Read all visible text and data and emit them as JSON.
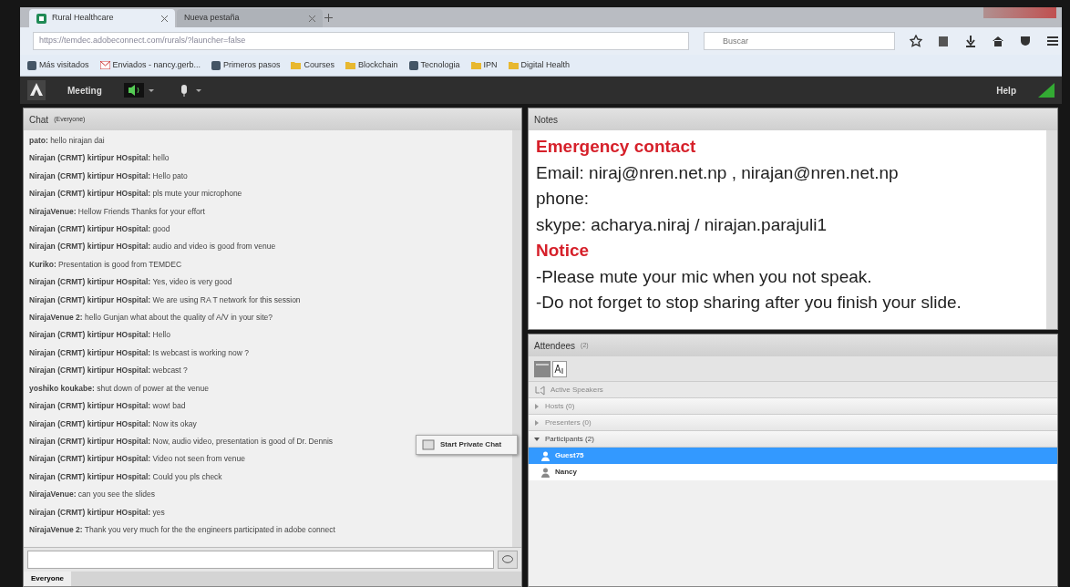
{
  "browser": {
    "tabs": [
      {
        "label": "Rural Healthcare",
        "selected": true
      },
      {
        "label": "Nueva pestaña",
        "selected": false
      }
    ],
    "url": "https://temdec.adobeconnect.com/rurals/?launcher=false",
    "search": {
      "placeholder": "Buscar"
    },
    "bookmarks": [
      {
        "label": "Más visitados",
        "kind": "site"
      },
      {
        "label": "Enviados - nancy.gerb...",
        "kind": "mail"
      },
      {
        "label": "Primeros pasos",
        "kind": "site"
      },
      {
        "label": "Courses",
        "kind": "folder"
      },
      {
        "label": "Blockchain",
        "kind": "folder"
      },
      {
        "label": "Tecnologia",
        "kind": "site"
      },
      {
        "label": "IPN",
        "kind": "folder"
      },
      {
        "label": "Digital Health",
        "kind": "folder"
      }
    ]
  },
  "app_menu": [
    {
      "label": "Meeting"
    },
    {
      "label": "Help"
    }
  ],
  "chat": {
    "title": "Chat",
    "subtitle": "(Everyone)",
    "messages": [
      {
        "sender": "pato:",
        "text": "hello nirajan dai"
      },
      {
        "sender": "Nirajan (CRMT) kirtipur HOspital:",
        "text": "hello"
      },
      {
        "sender": "Nirajan (CRMT) kirtipur HOspital:",
        "text": "Hello pato"
      },
      {
        "sender": "Nirajan (CRMT) kirtipur HOspital:",
        "text": "pls mute your microphone"
      },
      {
        "sender": "NirajaVenue:",
        "text": "Hellow Friends Thanks for your effort"
      },
      {
        "sender": "Nirajan (CRMT) kirtipur HOspital:",
        "text": "good"
      },
      {
        "sender": "Nirajan (CRMT) kirtipur HOspital:",
        "text": "audio and video is good from venue"
      },
      {
        "sender": "Kuriko:",
        "text": "Presentation is good from TEMDEC"
      },
      {
        "sender": "Nirajan (CRMT) kirtipur HOspital:",
        "text": "Yes, video is very good"
      },
      {
        "sender": "Nirajan (CRMT) kirtipur HOspital:",
        "text": "We are using RA T network for this session"
      },
      {
        "sender": "NirajaVenue 2:",
        "text": "hello Gunjan what about the quality of A/V in your site?"
      },
      {
        "sender": "Nirajan (CRMT) kirtipur HOspital:",
        "text": "Hello"
      },
      {
        "sender": "Nirajan (CRMT) kirtipur HOspital:",
        "text": "Is webcast is working now ?"
      },
      {
        "sender": "Nirajan (CRMT) kirtipur HOspital:",
        "text": "webcast ?"
      },
      {
        "sender": "yoshiko koukabe:",
        "text": "shut down of power at the venue"
      },
      {
        "sender": "Nirajan (CRMT) kirtipur HOspital:",
        "text": "wow! bad"
      },
      {
        "sender": "Nirajan (CRMT) kirtipur HOspital:",
        "text": "Now its okay"
      },
      {
        "sender": "Nirajan (CRMT) kirtipur HOspital:",
        "text": "Now, audio video, presentation is good of Dr. Dennis"
      },
      {
        "sender": "Nirajan (CRMT) kirtipur HOspital:",
        "text": "Video not seen from venue"
      },
      {
        "sender": "Nirajan (CRMT) kirtipur HOspital:",
        "text": "Could you pls check"
      },
      {
        "sender": "NirajaVenue:",
        "text": "can you see the slides"
      },
      {
        "sender": "Nirajan (CRMT) kirtipur HOspital:",
        "text": "yes"
      },
      {
        "sender": "NirajaVenue 2:",
        "text": "Thank you very much for the the engineers participated in adobe connect"
      }
    ],
    "tabs": [
      {
        "label": "Everyone",
        "selected": true
      }
    ]
  },
  "context_menu": {
    "items": [
      {
        "label": "Start Private Chat"
      }
    ]
  },
  "notes": {
    "title": "Notes",
    "lines": [
      {
        "kind": "heading",
        "text": "Emergency contact"
      },
      {
        "kind": "body",
        "text": "Email: niraj@nren.net.np , nirajan@nren.net.np"
      },
      {
        "kind": "body",
        "text": "phone:"
      },
      {
        "kind": "body",
        "text": "skype: acharya.niraj / nirajan.parajuli1"
      },
      {
        "kind": "heading",
        "text": "Notice"
      },
      {
        "kind": "body",
        "text": "-Please mute your mic when you not speak."
      },
      {
        "kind": "body",
        "text": "-Do not forget to stop sharing after you finish your slide."
      }
    ]
  },
  "attendees": {
    "title": "Attendees",
    "count": "(2)",
    "active_speakers": "Active Speakers",
    "groups": [
      {
        "label": "Hosts (0)",
        "expanded": false
      },
      {
        "label": "Presenters (0)",
        "expanded": false
      },
      {
        "label": "Participants (2)",
        "expanded": true,
        "people": [
          {
            "name": "Guest75",
            "selected": true
          },
          {
            "name": "Nancy",
            "selected": false
          }
        ]
      }
    ]
  }
}
